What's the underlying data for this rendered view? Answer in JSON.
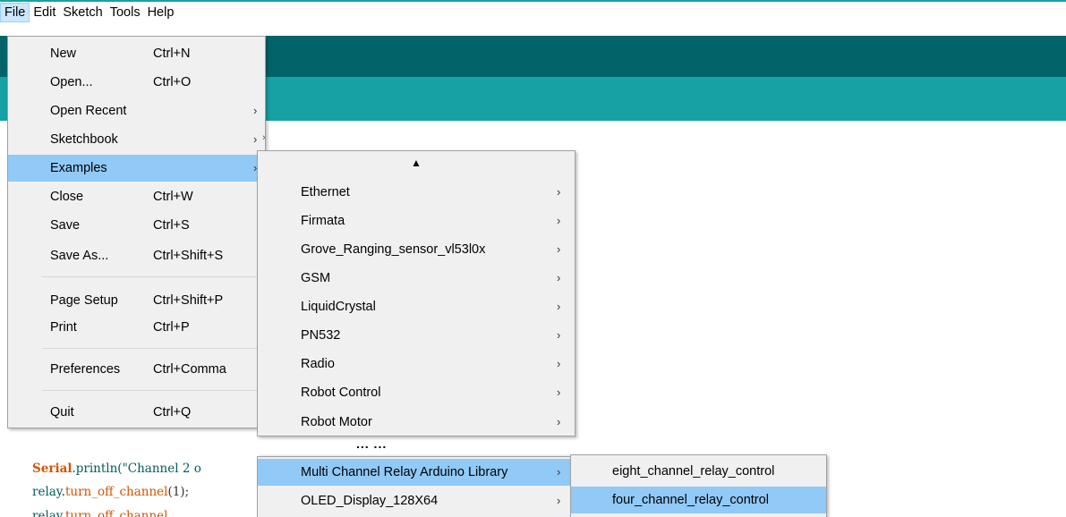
{
  "menubar": [
    "File",
    "Edit",
    "Sketch",
    "Tools",
    "Help"
  ],
  "file_menu": {
    "items": [
      {
        "label": "New",
        "shortcut": "Ctrl+N"
      },
      {
        "label": "Open...",
        "shortcut": "Ctrl+O"
      },
      {
        "label": "Open Recent",
        "shortcut": ""
      },
      {
        "label": "Sketchbook",
        "shortcut": ""
      },
      {
        "label": "Examples",
        "shortcut": ""
      },
      {
        "label": "Close",
        "shortcut": "Ctrl+W"
      },
      {
        "label": "Save",
        "shortcut": "Ctrl+S"
      },
      {
        "label": "Save As...",
        "shortcut": "Ctrl+Shift+S"
      },
      {
        "label": "Page Setup",
        "shortcut": "Ctrl+Shift+P"
      },
      {
        "label": "Print",
        "shortcut": "Ctrl+P"
      },
      {
        "label": "Preferences",
        "shortcut": "Ctrl+Comma"
      },
      {
        "label": "Quit",
        "shortcut": "Ctrl+Q"
      }
    ],
    "submenu_arrow": "›"
  },
  "examples_menu": {
    "scroll_up": "▲",
    "items": [
      "Ethernet",
      "Firmata",
      "Grove_Ranging_sensor_vl53l0x",
      "GSM",
      "LiquidCrystal",
      "PN532",
      "Radio",
      "Robot Control",
      "Robot Motor"
    ],
    "ellipsis": "... ...",
    "items2": [
      "Multi Channel Relay Arduino Library",
      "OLED_Display_128X64"
    ]
  },
  "relay_menu": {
    "items": [
      "eight_channel_relay_control",
      "four_channel_relay_control"
    ]
  },
  "code": {
    "line1_obj": "Serial",
    "line1_rest": ".println(\"Channel 2 o",
    "line2_obj": "relay",
    "line2_fn": "turn_off_channel",
    "line2_rest": "(1);"
  },
  "colors": {
    "header_dark": "#006468",
    "header_teal": "#17a1a5",
    "menu_bg": "#f0f0f0",
    "highlight": "#91c9f7"
  }
}
